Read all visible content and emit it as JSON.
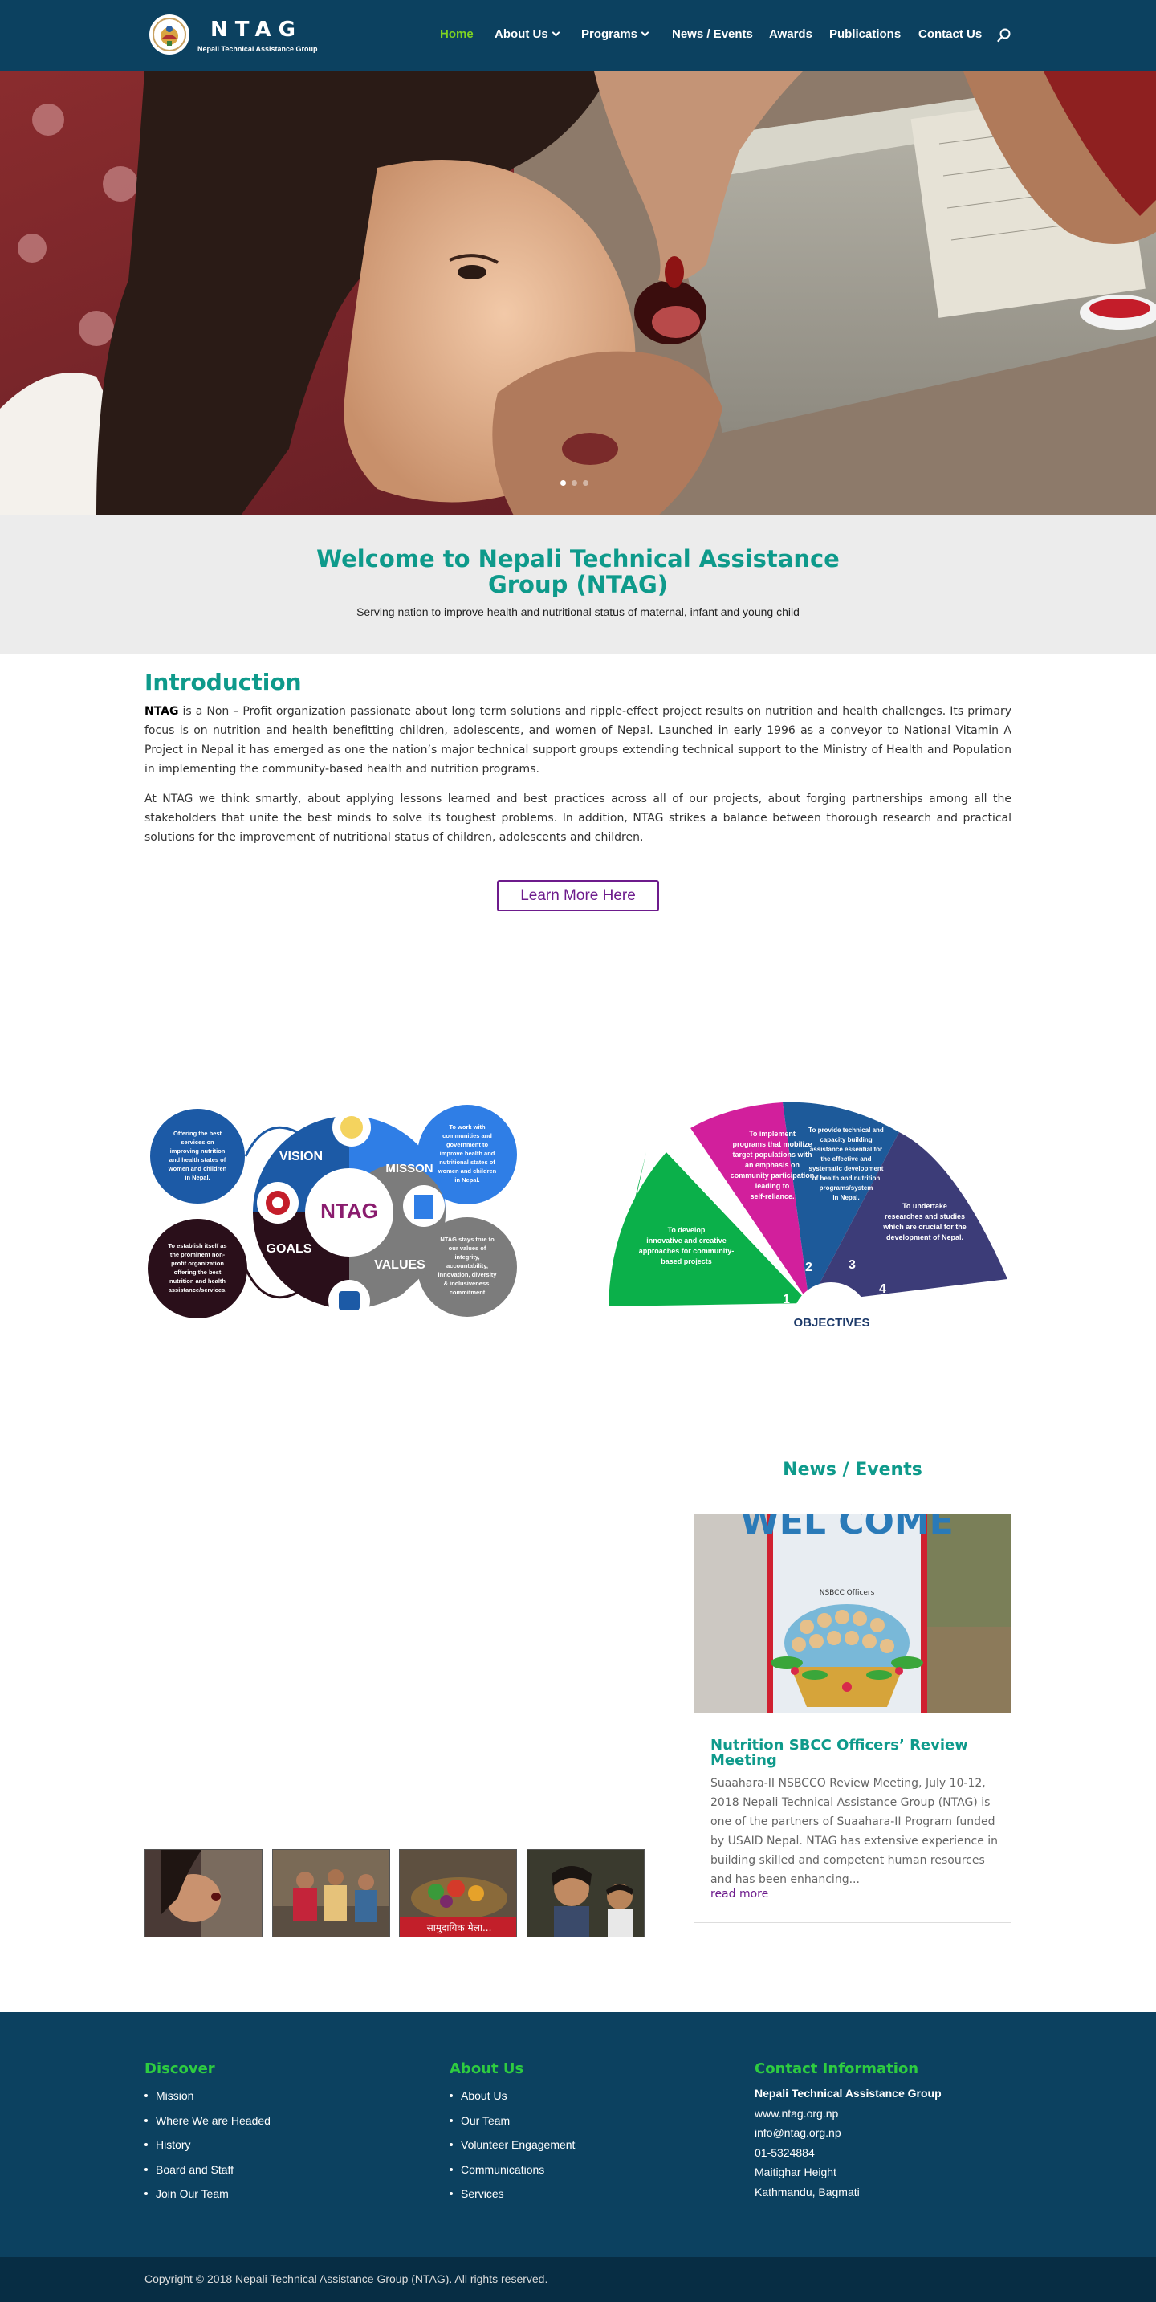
{
  "brand": {
    "name": "NTAG",
    "subtitle": "Nepali Technical Assistance Group"
  },
  "nav": {
    "items": [
      {
        "label": "Home",
        "active": true,
        "has_dropdown": false
      },
      {
        "label": "About Us",
        "active": false,
        "has_dropdown": true
      },
      {
        "label": "Programs",
        "active": false,
        "has_dropdown": true
      },
      {
        "label": "News / Events",
        "active": false,
        "has_dropdown": false
      },
      {
        "label": "Awards",
        "active": false,
        "has_dropdown": false
      },
      {
        "label": "Publications",
        "active": false,
        "has_dropdown": false
      },
      {
        "label": "Contact Us",
        "active": false,
        "has_dropdown": false
      }
    ],
    "search_icon": "search-icon"
  },
  "hero": {
    "slide_count": 3,
    "active_slide": 1
  },
  "welcome": {
    "title": "Welcome to Nepali Technical Assistance Group (NTAG)",
    "subtitle": "Serving nation to improve health and nutritional status of maternal, infant and young child"
  },
  "intro": {
    "title": "Introduction",
    "p1_lead": "NTAG",
    "p1_rest": " is a Non – Profit organization passionate about long term solutions and ripple-effect project results on nutrition and health challenges. Its primary focus is on nutrition and health benefitting children, adolescents, and women of Nepal. Launched in early 1996 as a conveyor to National Vitamin A Project in Nepal it has emerged as one the nation’s major technical support groups extending technical support to the Ministry of Health and Population in implementing the community-based health and nutrition programs.",
    "p2": "At NTAG we think smartly, about applying lessons learned and best practices across all of our projects, about forging partnerships among all the stakeholders that unite the best minds to solve its toughest problems. In addition, NTAG strikes a balance between thorough research and practical solutions for the improvement of nutritional status of children, adolescents and children.",
    "button": "Learn More Here"
  },
  "vmgv": {
    "center": "NTAG",
    "vision_label": "VISION",
    "mission_label": "MISSON",
    "goals_label": "GOALS",
    "values_label": "VALUES",
    "vision_text": [
      "Offering the best",
      "services on",
      "improving nutrition",
      "and health states of",
      "women and children",
      "in Nepal."
    ],
    "mission_text": [
      "To work with",
      "communities and",
      "government to",
      "improve health and",
      "nutritional states of",
      "women and children",
      "in Nepal."
    ],
    "goals_text": [
      "To establish itself as",
      "the prominent non-",
      "profit organization",
      "offering the best",
      "nutrition and health",
      "assistance/services."
    ],
    "values_text": [
      "NTAG stays true to",
      "our values of",
      "integrity,",
      "accountability,",
      "innovation, diversity",
      "& inclusiveness,",
      "commitment"
    ]
  },
  "objectives": {
    "center": "OBJECTIVES",
    "items": [
      {
        "num": "1",
        "lines": [
          "To develop",
          "innovative and creative",
          "approaches for community-",
          "based projects"
        ]
      },
      {
        "num": "2",
        "lines": [
          "To implement",
          "programs that mobilize",
          "target populations with",
          "an emphasis on",
          "community participation",
          "leading to",
          "self-reliance."
        ]
      },
      {
        "num": "3",
        "lines": [
          "To provide technical and",
          "capacity building",
          "assistance essential for",
          "the effective and",
          "systematic development",
          "of health and nutrition",
          "programs/system",
          "in Nepal."
        ]
      },
      {
        "num": "4",
        "lines": [
          "To undertake",
          "researches and studies",
          "which are crucial for the",
          "development of Nepal."
        ]
      }
    ]
  },
  "news": {
    "heading": "News / Events",
    "image_banner_text": "WEL COME",
    "image_sub_text": "NSBCC Officers",
    "title": "Nutrition SBCC Officers’ Review Meeting",
    "excerpt": "Suaahara-II NSBCCO Review Meeting, July 10-12, 2018 Nepali Technical Assistance Group (NTAG) is one of the partners of Suaahara-II Program funded by USAID Nepal.  NTAG has extensive experience in building skilled and competent human resources and has been enhancing...",
    "read_more": "read more"
  },
  "gallery_banner_text": "सामुदायिक मेला...",
  "footer": {
    "discover": {
      "heading": "Discover",
      "items": [
        "Mission",
        "Where We are Headed",
        "History",
        "Board and Staff",
        "Join Our Team"
      ]
    },
    "about": {
      "heading": "About Us",
      "items": [
        "About Us",
        "Our Team",
        "Volunteer Engagement",
        "Communications",
        "Services"
      ]
    },
    "contact": {
      "heading": "Contact Information",
      "org": "Nepali Technical Assistance Group",
      "lines": [
        "www.ntag.org.np",
        "info@ntag.org.np",
        "01-5324884",
        "Maitighar Height",
        "Kathmandu, Bagmati"
      ]
    },
    "copyright": "Copyright © 2018 Nepali Technical Assistance Group (NTAG). All rights reserved."
  },
  "colors": {
    "header_bg": "#0c4160",
    "accent_teal": "#0e9a8b",
    "nav_active": "#7ed321",
    "button_purple": "#6d1b8c",
    "footer_heading": "#2ecc40"
  }
}
